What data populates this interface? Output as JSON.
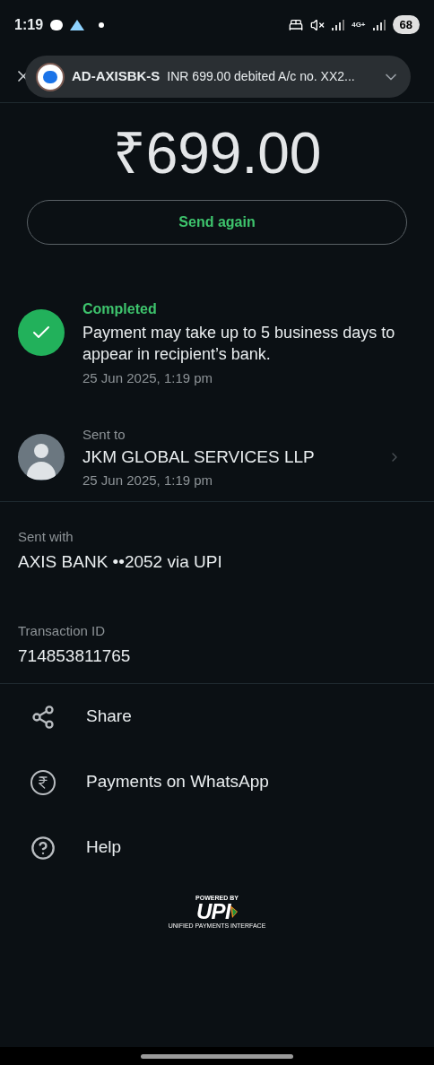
{
  "status_bar": {
    "time": "1:19",
    "network": "4G+",
    "battery": "68"
  },
  "notification": {
    "sender": "AD-AXISBK-S",
    "message": "INR 699.00 debited A/c no. XX2..."
  },
  "amount": "₹699.00",
  "send_again": "Send again",
  "status": {
    "label": "Completed",
    "message": "Payment may take up to 5 business days to appear in recipient’s bank.",
    "time": "25 Jun 2025, 1:19 pm"
  },
  "recipient": {
    "label": "Sent to",
    "name": "JKM GLOBAL SERVICES LLP",
    "time": "25 Jun 2025, 1:19 pm"
  },
  "details": [
    {
      "label": "Sent with",
      "value": "AXIS BANK ••2052 via UPI"
    },
    {
      "label": "Transaction ID",
      "value": "714853811765"
    }
  ],
  "actions": [
    {
      "kind": "share",
      "label": "Share"
    },
    {
      "kind": "rupee",
      "label": "Payments on WhatsApp"
    },
    {
      "kind": "help",
      "label": "Help"
    }
  ],
  "footer": {
    "powered": "POWERED BY",
    "logo": "UPI",
    "tagline": "UNIFIED PAYMENTS INTERFACE"
  }
}
